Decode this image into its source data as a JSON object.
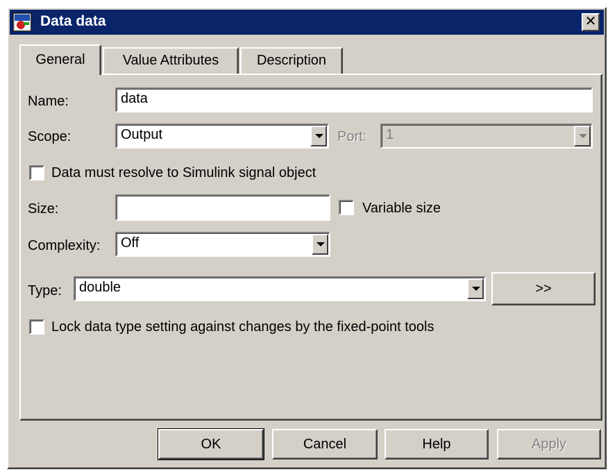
{
  "window": {
    "title": "Data data",
    "close_glyph": "✕",
    "title_bar_color": "#0a246a"
  },
  "tabs": [
    {
      "label": "General",
      "active": true
    },
    {
      "label": "Value Attributes",
      "active": false
    },
    {
      "label": "Description",
      "active": false
    }
  ],
  "general": {
    "name": {
      "label": "Name:",
      "value": "data"
    },
    "scope": {
      "label": "Scope:",
      "value": "Output"
    },
    "port": {
      "label": "Port:",
      "value": "1",
      "enabled": false
    },
    "resolve_signal": {
      "label": "Data must resolve to Simulink signal object",
      "checked": false
    },
    "size": {
      "label": "Size:",
      "value": ""
    },
    "variable_size": {
      "label": "Variable size",
      "checked": false
    },
    "complexity": {
      "label": "Complexity:",
      "value": "Off"
    },
    "type": {
      "label": "Type:",
      "value": "double",
      "expand_label": ">>"
    },
    "lock_type": {
      "label": "Lock data type setting against changes by the fixed-point tools",
      "checked": false
    }
  },
  "buttons": {
    "ok": "OK",
    "cancel": "Cancel",
    "help": "Help",
    "apply": "Apply"
  },
  "icons": {
    "app": "simulink-data-icon",
    "close": "close-icon",
    "dropdown": "chevron-down-icon"
  }
}
